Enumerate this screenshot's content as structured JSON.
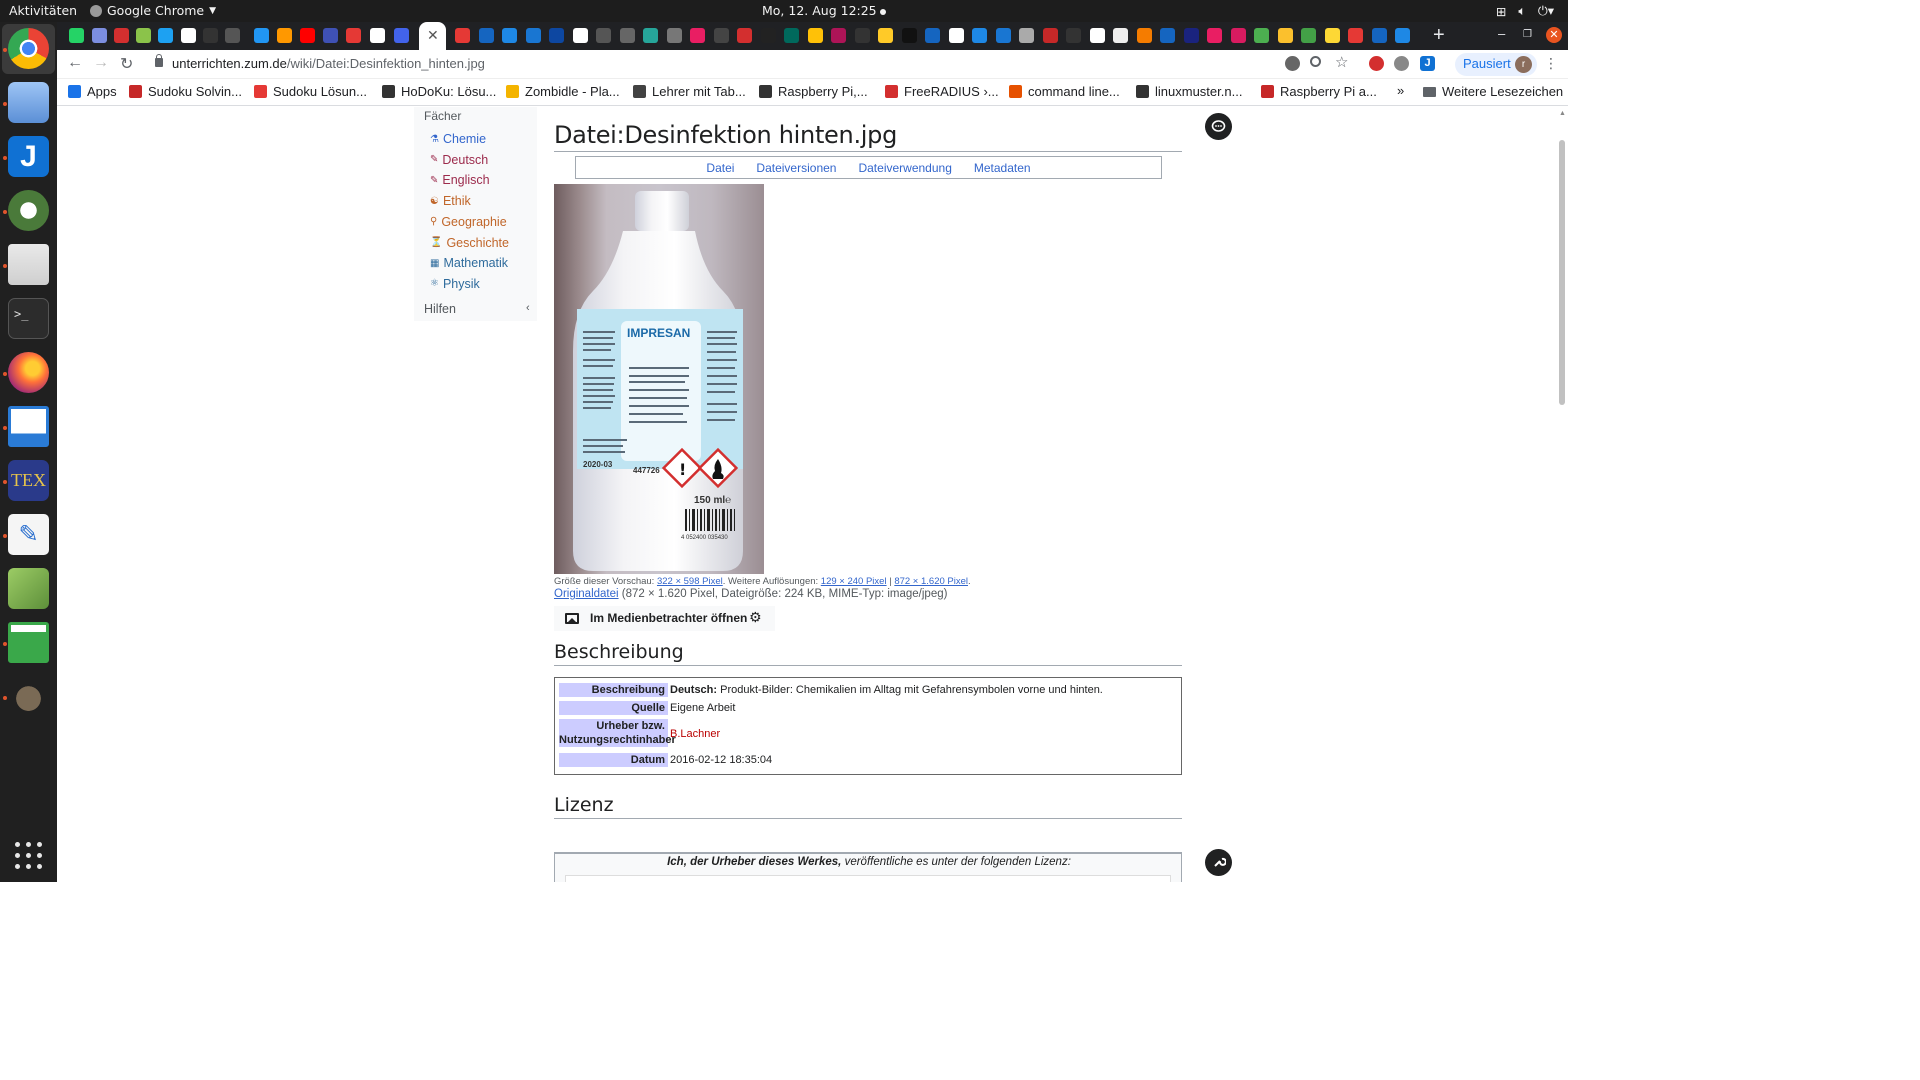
{
  "topbar": {
    "activities": "Aktivitäten",
    "app_name": "Google Chrome",
    "clock": "Mo, 12. Aug  12:25"
  },
  "dock": {
    "items": [
      "chrome",
      "mail",
      "joplin",
      "keepassxc",
      "files",
      "terminal",
      "firefox",
      "writer",
      "texstudio",
      "text-editor",
      "stellarium",
      "calc",
      "gimp"
    ]
  },
  "toolbar": {
    "url_host": "unterrichten.zum.de",
    "url_path": "/wiki/Datei:Desinfektion_hinten.jpg",
    "profile_label": "Pausiert",
    "profile_initial": "r"
  },
  "bookmarks": [
    {
      "label": "Apps",
      "color": "#1a73e8"
    },
    {
      "label": "Sudoku Solvin...",
      "color": "#c62828"
    },
    {
      "label": "Sudoku Lösun...",
      "color": "#e53935"
    },
    {
      "label": "HoDoKu: Lösu...",
      "color": "#333333"
    },
    {
      "label": "Zombidle - Pla...",
      "color": "#f4b400"
    },
    {
      "label": "Lehrer mit Tab...",
      "color": "#424242"
    },
    {
      "label": "Raspberry Pi,...",
      "color": "#333333"
    },
    {
      "label": "FreeRADIUS ›...",
      "color": "#d32f2f"
    },
    {
      "label": "command line...",
      "color": "#e65100"
    },
    {
      "label": "linuxmuster.n...",
      "color": "#333333"
    },
    {
      "label": "Raspberry Pi a...",
      "color": "#c62828"
    }
  ],
  "bookmarks_more": "»",
  "bookmarks_folder": "Weitere Lesezeichen",
  "sidebar": {
    "heading": "Fächer",
    "items": [
      {
        "label": "Chemie",
        "color": "#3366cc"
      },
      {
        "label": "Deutsch",
        "color": "#9c2b4c"
      },
      {
        "label": "Englisch",
        "color": "#9c2b4c"
      },
      {
        "label": "Ethik",
        "color": "#c0662a"
      },
      {
        "label": "Geographie",
        "color": "#c0662a"
      },
      {
        "label": "Geschichte",
        "color": "#c0662a"
      },
      {
        "label": "Mathematik",
        "color": "#2e6b9c"
      },
      {
        "label": "Physik",
        "color": "#2e6b9c"
      }
    ],
    "help": "Hilfen",
    "help_caret": "‹"
  },
  "content": {
    "title": "Datei:Desinfektion hinten.jpg",
    "file_tabs": [
      "Datei",
      "Dateiversionen",
      "Dateiverwendung",
      "Metadaten"
    ],
    "caption_prefix": "Größe dieser Vorschau: ",
    "caption_link1": "322 × 598 Pixel",
    "caption_mid": ". Weitere Auflösungen: ",
    "caption_link2": "129 × 240 Pixel",
    "caption_sep": " | ",
    "caption_link3": "872 × 1.620 Pixel",
    "caption_end": ".",
    "orig_link": "Originaldatei",
    "orig_info": " (872 × 1.620 Pixel, Dateigröße: 224 KB, MIME-Typ: image/jpeg)",
    "media_button": "Im Medienbetrachter öffnen",
    "section_desc": "Beschreibung",
    "info": {
      "desc_key": "Beschreibung",
      "desc_lang": "Deutsch:",
      "desc_val": " Produkt-Bilder: Chemikalien im Alltag mit Gefahrensymbolen vorne und hinten.",
      "source_key": "Quelle",
      "source_val": "Eigene Arbeit",
      "author_key1": "Urheber bzw.",
      "author_key2": "Nutzungsrechtinhaber",
      "author_val": "B.Lachner",
      "date_key": "Datum",
      "date_val": "2016-02-12 18:35:04"
    },
    "section_license": "Lizenz",
    "license_bold": "Ich, der Urheber dieses Werkes,",
    "license_rest": " veröffentliche es unter der folgenden Lizenz:"
  },
  "photo_text": {
    "brand": "IMPRESAN",
    "date_code": "2020-03",
    "batch": "447726",
    "volume": "150 ml℮",
    "barcode": "4 052400 035430"
  },
  "colors": {
    "link": "#3366cc",
    "table_key_bg": "#ccccff",
    "red_link": "#ba0000"
  }
}
